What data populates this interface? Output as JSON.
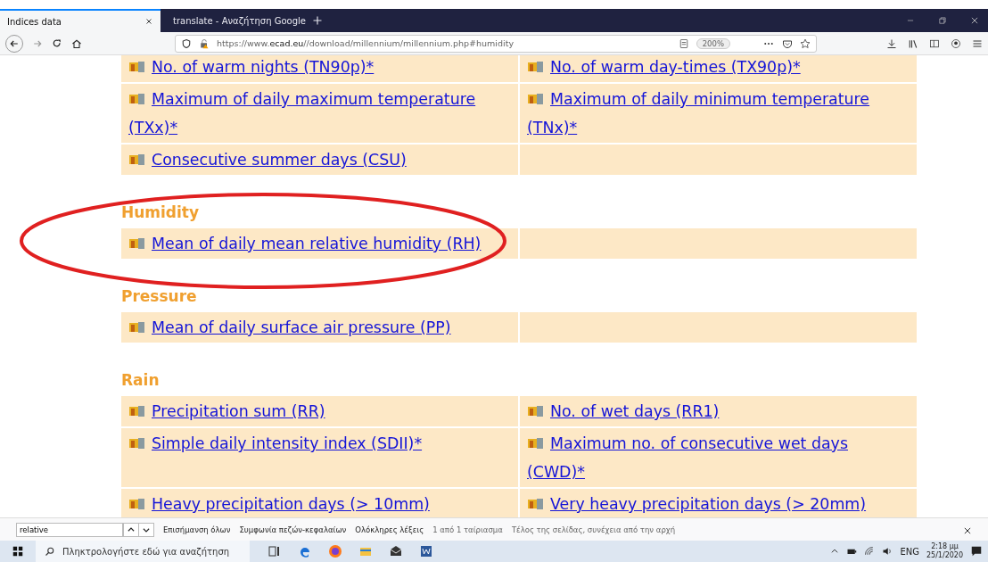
{
  "tabs": [
    {
      "label": "Indices data",
      "selected": true
    },
    {
      "label": "translate - Αναζήτηση Google",
      "selected": false
    }
  ],
  "address_bar": {
    "url_prefix": "https://www.",
    "url_domain": "ecad.eu",
    "url_path": "//download/millennium/millennium.php#humidity",
    "zoom": "200%"
  },
  "sections": [
    {
      "rows": [
        [
          {
            "text": "No. of warm nights (TN90p)*"
          },
          {
            "text": "No. of warm day-times (TX90p)*"
          }
        ],
        [
          {
            "text": "Maximum of daily maximum temperature (TXx)*"
          },
          {
            "text": "Maximum of daily minimum temperature (TNx)*"
          }
        ],
        [
          {
            "text": "Consecutive summer days (CSU)"
          }
        ]
      ]
    },
    {
      "heading": "Humidity",
      "annotation": {
        "kind": "ellipse"
      },
      "rows": [
        [
          {
            "text": "Mean of daily mean relative humidity (RH)"
          }
        ]
      ]
    },
    {
      "heading": "Pressure",
      "rows": [
        [
          {
            "text": "Mean of daily surface air pressure (PP)"
          }
        ]
      ]
    },
    {
      "heading": "Rain",
      "rows": [
        [
          {
            "text": "Precipitation sum (RR)"
          },
          {
            "text": "No. of wet days (RR1)"
          }
        ],
        [
          {
            "text": "Simple daily intensity index (SDII)*"
          },
          {
            "text": "Maximum no. of consecutive wet days (CWD)*"
          }
        ],
        [
          {
            "text": "Heavy precipitation days (> 10mm)"
          },
          {
            "text": "Very heavy precipitation days (> 20mm)"
          }
        ]
      ]
    }
  ],
  "find_bar": {
    "value": "relative",
    "options": [
      "Επισήμανση όλων",
      "Συμφωνία πεζών-κεφαλαίων",
      "Ολόκληρες λέξεις"
    ],
    "matches": "1 από 1 ταίριασμα",
    "status": "Τέλος της σελίδας, συνέχεια από την αρχή"
  },
  "taskbar": {
    "search_placeholder": "Πληκτρολογήστε εδώ για αναζήτηση",
    "language": "ENG",
    "time": "2:18 μμ",
    "date": "25/1/2020"
  }
}
